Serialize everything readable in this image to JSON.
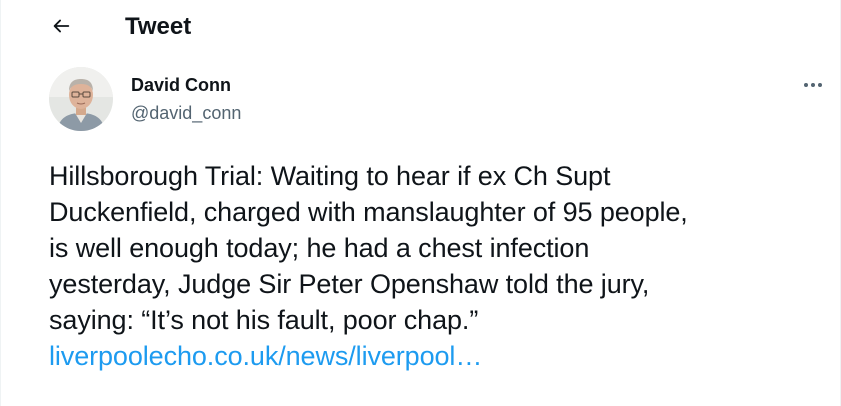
{
  "header": {
    "title": "Tweet"
  },
  "author": {
    "name": "David Conn",
    "handle": "@david_conn"
  },
  "tweet": {
    "lines": [
      "Hillsborough Trial: Waiting to hear if ex Ch Supt",
      "Duckenfield, charged with manslaughter of 95 people,",
      "is well enough today; he had a chest infection",
      "yesterday, Judge Sir Peter Openshaw told the jury,",
      "saying: “It’s not his fault, poor chap.”"
    ],
    "link_text": "liverpoolecho.co.uk/news/liverpool…"
  },
  "icons": {
    "back": "arrow-left-icon",
    "more": "more-horizontal-icon"
  },
  "colors": {
    "text": "#0f1419",
    "secondary": "#536471",
    "link": "#1d9bf0"
  }
}
